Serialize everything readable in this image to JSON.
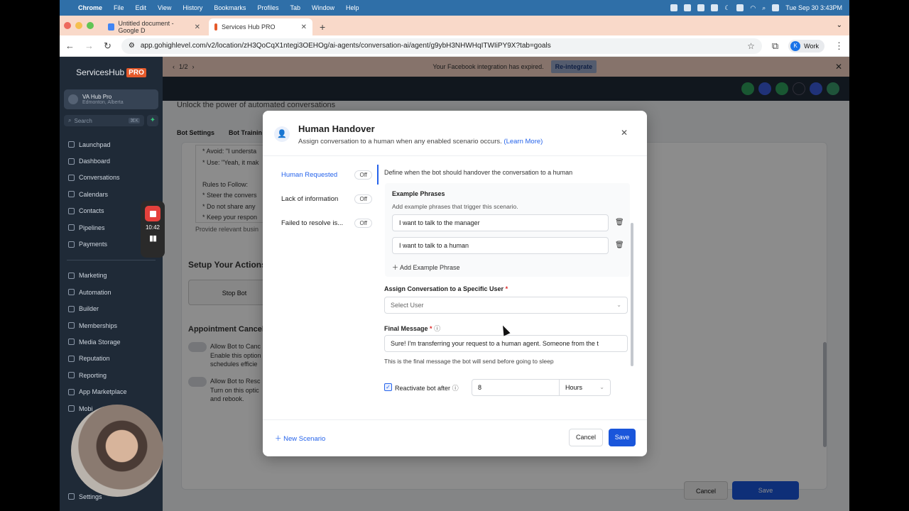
{
  "menubar": {
    "app": "Chrome",
    "items": [
      "File",
      "Edit",
      "View",
      "History",
      "Bookmarks",
      "Profiles",
      "Tab",
      "Window",
      "Help"
    ],
    "clock": "Tue Sep 30  3:43PM"
  },
  "browser": {
    "tabs": [
      {
        "title": "Untitled document - Google D"
      },
      {
        "title": "Services Hub PRO"
      }
    ],
    "url": "app.gohighlevel.com/v2/location/zH3QoCqX1ntegi3OEHOg/ai-agents/conversation-ai/agent/g9ybH3NHWHqITWIiPY9X?tab=goals",
    "profile": "Work",
    "profile_initial": "K"
  },
  "sidebar": {
    "brand": "ServicesHub",
    "brand_badge": "PRO",
    "location_name": "VA Hub Pro",
    "location_city": "Edmonton, Alberta",
    "search_placeholder": "Search",
    "search_shortcut": "⌘K",
    "items_top": [
      "Launchpad",
      "Dashboard",
      "Conversations",
      "Calendars",
      "Contacts",
      "Pipelines",
      "Payments"
    ],
    "items_bottom": [
      "Marketing",
      "Automation",
      "Builder",
      "Memberships",
      "Media Storage",
      "Reputation",
      "Reporting",
      "App Marketplace",
      "Mobi"
    ],
    "settings": "Settings"
  },
  "recorder": {
    "time": "10:42"
  },
  "banner": {
    "pager": "1/2",
    "message": "Your Facebook integration has expired.",
    "action": "Re-integrate"
  },
  "page": {
    "subtitle": "Unlock the power of automated conversations",
    "tabs": [
      "Bot Settings",
      "Bot Trainin"
    ],
    "prompt_lines": [
      "* Avoid: \"I understa",
      "* Use: \"Yeah, it mak",
      "",
      "Rules to Follow:",
      "* Steer the convers",
      "* Do not share any",
      "* Keep your respon"
    ],
    "prompt_help": "Provide relevant busin",
    "actions_title": "Setup Your Actions",
    "stop_bot": "Stop Bot",
    "appt_title": "Appointment Cancel",
    "toggle1_title": "Allow Bot to Canc",
    "toggle1_desc": "Enable this option",
    "toggle1_desc2": "schedules efficie",
    "toggle2_title": "Allow Bot to Resc",
    "toggle2_desc": "Turn on this optic",
    "toggle2_desc2": "and rebook.",
    "cancel": "Cancel",
    "save": "Save"
  },
  "modal": {
    "title": "Human Handover",
    "description": "Assign conversation to a human when any enabled scenario occurs.",
    "learn_more": "(Learn More)",
    "scenarios": [
      {
        "label": "Human Requested",
        "state": "Off"
      },
      {
        "label": "Lack of information",
        "state": "Off"
      },
      {
        "label": "Failed to resolve is...",
        "state": "Off"
      }
    ],
    "definition": "Define when the bot should handover the conversation to a human",
    "example_title": "Example Phrases",
    "example_sub": "Add example phrases that trigger this scenario.",
    "phrases": [
      "I want to talk to the manager",
      "I want to talk to a human"
    ],
    "add_phrase": "Add Example Phrase",
    "assign_label": "Assign Conversation to a Specific User",
    "assign_placeholder": "Select User",
    "final_label": "Final Message",
    "final_value": "Sure! I'm transferring your request to a human agent. Someone from the t",
    "final_help": "This is the final message the bot will send before going to sleep",
    "reactivate_label": "Reactivate bot after",
    "reactivate_value": "8",
    "reactivate_unit": "Hours",
    "new_scenario": "New Scenario",
    "cancel": "Cancel",
    "save": "Save"
  },
  "colors": {
    "accent": "#1a56db",
    "sidebar_bg": "#1f2a37",
    "brand_badge": "#e55a2b"
  }
}
